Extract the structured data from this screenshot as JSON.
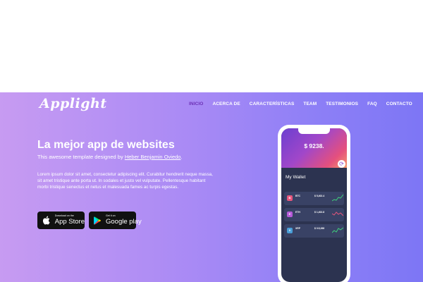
{
  "brand": {
    "logo": "Applight"
  },
  "nav": {
    "items": [
      {
        "label": "INICIO",
        "active": true
      },
      {
        "label": "ACERCA DE",
        "active": false
      },
      {
        "label": "CARACTERÍSTICAS",
        "active": false
      },
      {
        "label": "TEAM",
        "active": false
      },
      {
        "label": "TESTIMONIOS",
        "active": false
      },
      {
        "label": "FAQ",
        "active": false
      },
      {
        "label": "CONTACTO",
        "active": false
      }
    ]
  },
  "hero": {
    "headline": "La mejor app de websites",
    "subline_prefix": "This awesome template designed by ",
    "subline_author": "Heber Benjamin Oviedo",
    "subline_suffix": ".",
    "paragraph": "Lorem ipsum dolor sit amet, consectetur adipiscing elit. Curabitur hendrerit neque massa, sit amet tristique ante porta ut. In sodales et justo vel vulputate. Pellentesque habitant morbi tristique senectus et netus et malesuada fames ac turpis egestas.",
    "buttons": {
      "appstore_small": "Download on the",
      "appstore_big": "App Store",
      "gplay_small": "Get it on",
      "gplay_big": "Google play"
    }
  },
  "phone": {
    "balance": "$ 9238.",
    "wallet_title": "My Wallet",
    "coins": [
      {
        "name": "BTC",
        "letter": "B",
        "value": "$ 5,402.4",
        "color": "#e7567c"
      },
      {
        "name": "ETH",
        "letter": "E",
        "value": "$ 1,402.8",
        "color": "#b65ad8"
      },
      {
        "name": "XRP",
        "letter": "X",
        "value": "$ 0.5,268",
        "color": "#4a9fd8"
      }
    ]
  },
  "colors": {
    "accent_nav": "#6b2fb5",
    "gradient_start": "#c79bf2",
    "gradient_end": "#7d76f5",
    "chart_green": "#3fd07a",
    "chart_pink": "#e7567c"
  },
  "icons": {
    "appstore": "apple-icon",
    "gplay": "google-play-icon"
  }
}
